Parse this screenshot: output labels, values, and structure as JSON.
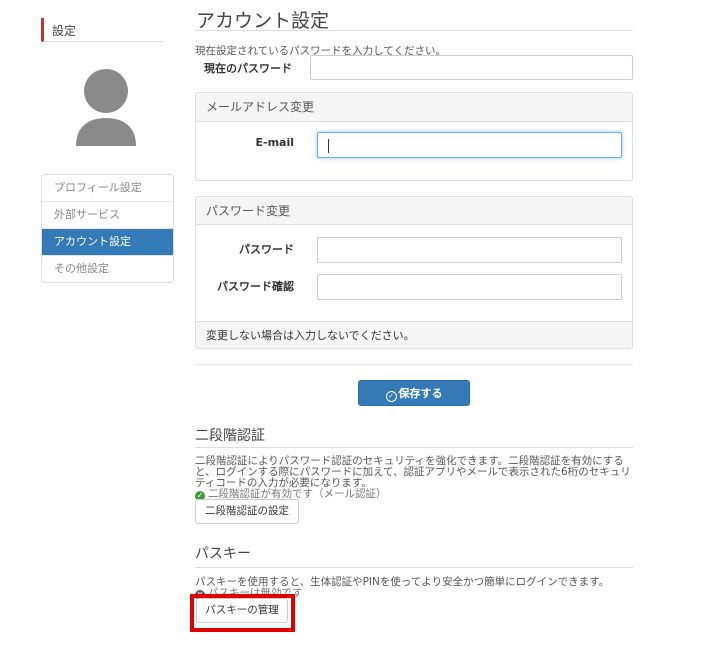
{
  "sidebar": {
    "title": "設定",
    "items": [
      {
        "label": "プロフィール設定"
      },
      {
        "label": "外部サービス"
      },
      {
        "label": "アカウント設定"
      },
      {
        "label": "その他設定"
      }
    ]
  },
  "main": {
    "title": "アカウント設定",
    "current_password": {
      "note": "現在設定されているパスワードを入力してください。",
      "label": "現在のパスワード",
      "value": ""
    },
    "email_panel": {
      "heading": "メールアドレス変更",
      "email_label": "E-mail",
      "email_value": ""
    },
    "password_panel": {
      "heading": "パスワード変更",
      "password_label": "パスワード",
      "confirm_label": "パスワード確認",
      "footer": "変更しない場合は入力しないでください。"
    },
    "save_label": "保存する",
    "two_factor": {
      "title": "二段階認証",
      "description_line1": "二段階認証によりパスワード認証のセキュリティを強化できます。二段階認証を有効にする",
      "description_line2": "と、ログインする際にパスワードに加えて、認証アプリやメールで表示された6桁のセキュリ",
      "description_line3": "ティコードの入力が必要になります。",
      "status": "二段階認証が有効です（メール認証）",
      "button_label": "二段階認証の設定"
    },
    "passkey": {
      "title": "パスキー",
      "description": "パスキーを使用すると、生体認証やPINを使ってより安全かつ簡単にログインできます。",
      "status": "パスキーは無効です",
      "button_label": "パスキーの管理"
    }
  },
  "colors": {
    "accent": "#337ab7",
    "sidebar_marker": "#c9302c",
    "highlight": "#e00000",
    "ok": "#3c9c3c"
  }
}
